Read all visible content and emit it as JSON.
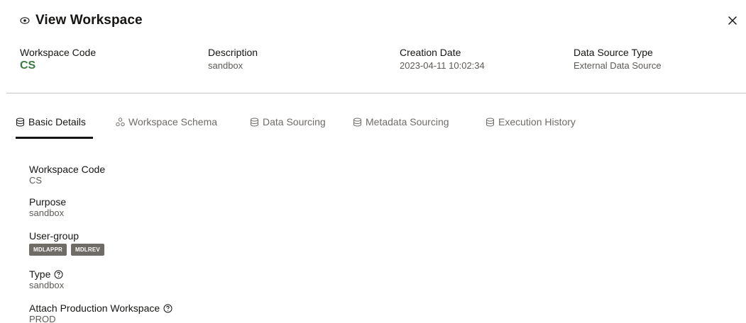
{
  "header": {
    "title": "View Workspace",
    "title_icon": "eye-icon",
    "close_icon": "close-icon"
  },
  "summary": {
    "workspace_code_label": "Workspace Code",
    "workspace_code_value": "CS",
    "description_label": "Description",
    "description_value": "sandbox",
    "creation_date_label": "Creation Date",
    "creation_date_value": "2023-04-11 10:02:34",
    "data_source_type_label": "Data Source Type",
    "data_source_type_value": "External Data Source"
  },
  "tabs": [
    {
      "label": "Basic Details",
      "icon": "database-icon",
      "active": true
    },
    {
      "label": "Workspace Schema",
      "icon": "schema-icon",
      "active": false
    },
    {
      "label": "Data Sourcing",
      "icon": "database-icon",
      "active": false
    },
    {
      "label": "Metadata Sourcing",
      "icon": "database-icon",
      "active": false
    },
    {
      "label": "Execution History",
      "icon": "database-icon",
      "active": false
    }
  ],
  "details": {
    "workspace_code_label": "Workspace Code",
    "workspace_code_value": "CS",
    "purpose_label": "Purpose",
    "purpose_value": "sandbox",
    "user_group_label": "User-group",
    "user_groups": [
      "MDLAPPR",
      "MDLREV"
    ],
    "type_label": "Type",
    "type_value": "sandbox",
    "attach_prod_label": "Attach Production Workspace",
    "attach_prod_value": "PROD"
  },
  "colors": {
    "code_accent": "#3b7b3f",
    "badge_bg": "#6f6b67",
    "text_primary": "#161513",
    "text_secondary": "#5e5a56"
  }
}
